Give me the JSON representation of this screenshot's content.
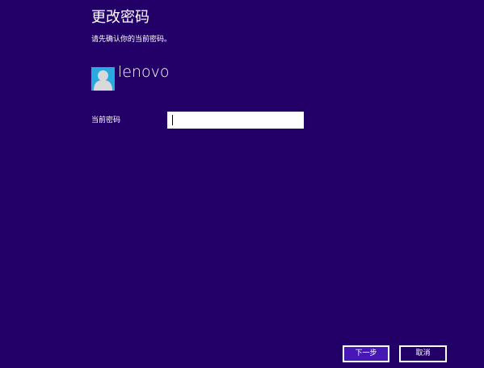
{
  "dialog": {
    "title": "更改密码",
    "subtitle": "请先确认你的当前密码。"
  },
  "user": {
    "name": "lenovo",
    "avatar_icon": "default-user-avatar"
  },
  "form": {
    "current_password_label": "当前密码",
    "current_password_value": "",
    "current_password_placeholder": ""
  },
  "buttons": {
    "next_label": "下一步",
    "cancel_label": "取消"
  },
  "colors": {
    "background": "#220067",
    "primary_button": "#4617b4",
    "avatar_background": "#2aa9e0"
  }
}
